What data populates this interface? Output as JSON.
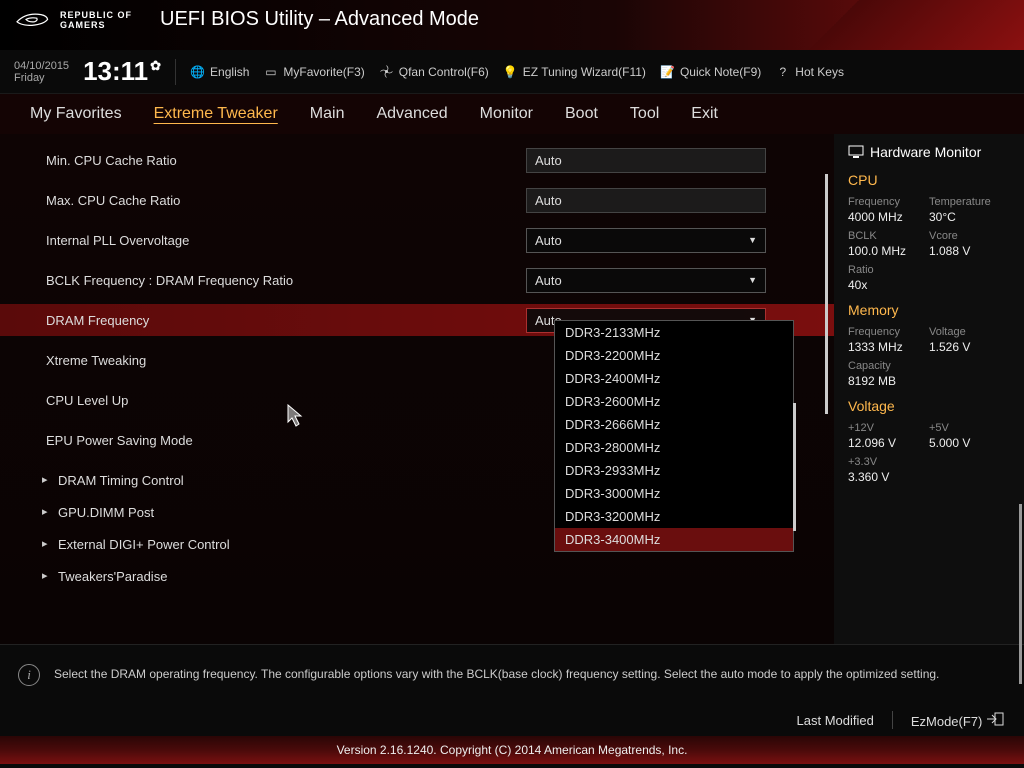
{
  "header": {
    "brand_line1": "REPUBLIC OF",
    "brand_line2": "GAMERS",
    "title": "UEFI BIOS Utility – Advanced Mode"
  },
  "toolbar": {
    "date": "04/10/2015",
    "day": "Friday",
    "time": "13:11",
    "items": [
      {
        "label": "English"
      },
      {
        "label": "MyFavorite(F3)"
      },
      {
        "label": "Qfan Control(F6)"
      },
      {
        "label": "EZ Tuning Wizard(F11)"
      },
      {
        "label": "Quick Note(F9)"
      },
      {
        "label": "Hot Keys"
      }
    ]
  },
  "tabs": [
    "My Favorites",
    "Extreme Tweaker",
    "Main",
    "Advanced",
    "Monitor",
    "Boot",
    "Tool",
    "Exit"
  ],
  "active_tab": 1,
  "settings": {
    "rows": [
      {
        "label": "Min. CPU Cache Ratio",
        "type": "input",
        "value": "Auto"
      },
      {
        "label": "Max. CPU Cache Ratio",
        "type": "input",
        "value": "Auto"
      },
      {
        "label": "Internal PLL Overvoltage",
        "type": "select",
        "value": "Auto"
      },
      {
        "label": "BCLK Frequency : DRAM Frequency Ratio",
        "type": "select",
        "value": "Auto"
      },
      {
        "label": "DRAM Frequency",
        "type": "select",
        "value": "Auto",
        "selected": true
      },
      {
        "label": "Xtreme Tweaking",
        "type": "none"
      },
      {
        "label": "CPU Level Up",
        "type": "none"
      },
      {
        "label": "EPU Power Saving Mode",
        "type": "none"
      },
      {
        "label": "DRAM Timing Control",
        "type": "sub"
      },
      {
        "label": "GPU.DIMM Post",
        "type": "sub"
      },
      {
        "label": "External DIGI+ Power Control",
        "type": "sub"
      },
      {
        "label": "Tweakers'Paradise",
        "type": "sub"
      }
    ]
  },
  "dropdown": {
    "options": [
      "DDR3-2133MHz",
      "DDR3-2200MHz",
      "DDR3-2400MHz",
      "DDR3-2600MHz",
      "DDR3-2666MHz",
      "DDR3-2800MHz",
      "DDR3-2933MHz",
      "DDR3-3000MHz",
      "DDR3-3200MHz",
      "DDR3-3400MHz"
    ],
    "hover": 9
  },
  "help": "Select the DRAM operating frequency. The configurable options vary with the BCLK(base clock) frequency setting. Select the auto mode to apply the optimized setting.",
  "hw": {
    "title": "Hardware Monitor",
    "cpu": {
      "title": "CPU",
      "freq_lbl": "Frequency",
      "freq_val": "4000 MHz",
      "temp_lbl": "Temperature",
      "temp_val": "30°C",
      "bclk_lbl": "BCLK",
      "bclk_val": "100.0 MHz",
      "vcore_lbl": "Vcore",
      "vcore_val": "1.088 V",
      "ratio_lbl": "Ratio",
      "ratio_val": "40x"
    },
    "mem": {
      "title": "Memory",
      "freq_lbl": "Frequency",
      "freq_val": "1333 MHz",
      "volt_lbl": "Voltage",
      "volt_val": "1.526 V",
      "cap_lbl": "Capacity",
      "cap_val": "8192 MB"
    },
    "volt": {
      "title": "Voltage",
      "v12_lbl": "+12V",
      "v12_val": "12.096 V",
      "v5_lbl": "+5V",
      "v5_val": "5.000 V",
      "v33_lbl": "+3.3V",
      "v33_val": "3.360 V"
    }
  },
  "footer": {
    "last_modified": "Last Modified",
    "ezmode": "EzMode(F7)",
    "copyright": "Version 2.16.1240. Copyright (C) 2014 American Megatrends, Inc."
  }
}
